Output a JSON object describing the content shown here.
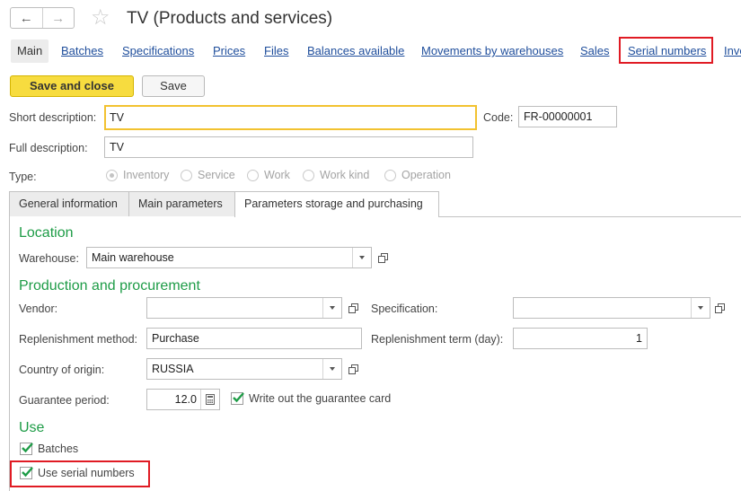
{
  "window": {
    "title": "TV (Products and services)",
    "favorite_icon": "star-outline-icon",
    "back_icon": "arrow-left-icon",
    "forward_icon": "arrow-right-icon"
  },
  "nav": {
    "links": [
      "Main",
      "Batches",
      "Specifications",
      "Prices",
      "Files",
      "Balances available",
      "Movements by warehouses",
      "Sales",
      "Serial numbers",
      "Inve"
    ],
    "active": "Main",
    "highlighted": "Serial numbers"
  },
  "toolbar": {
    "save_close_label": "Save and close",
    "save_label": "Save"
  },
  "form": {
    "short_description_label": "Short description:",
    "short_description_value": "TV",
    "code_label": "Code:",
    "code_value": "FR-00000001",
    "full_description_label": "Full description:",
    "full_description_value": "TV",
    "type_label": "Type:",
    "type_options": [
      "Inventory",
      "Service",
      "Work",
      "Work kind",
      "Operation"
    ],
    "type_selected": "Inventory"
  },
  "tabs": {
    "items": [
      "General information",
      "Main parameters",
      "Parameters storage and purchasing"
    ],
    "active": "Parameters storage and purchasing"
  },
  "location": {
    "heading": "Location",
    "warehouse_label": "Warehouse:",
    "warehouse_value": "Main warehouse"
  },
  "production": {
    "heading": "Production and procurement",
    "vendor_label": "Vendor:",
    "vendor_value": "",
    "specification_label": "Specification:",
    "specification_value": "",
    "replenishment_method_label": "Replenishment method:",
    "replenishment_method_value": "Purchase",
    "replenishment_term_label": "Replenishment term (day):",
    "replenishment_term_value": "1",
    "country_label": "Country of origin:",
    "country_value": "RUSSIA",
    "guarantee_label": "Guarantee period:",
    "guarantee_value": "12.0",
    "guarantee_card_label": "Write out the guarantee card",
    "guarantee_card_checked": true
  },
  "use": {
    "heading": "Use",
    "batches_label": "Batches",
    "batches_checked": true,
    "serial_label": "Use serial numbers",
    "serial_checked": true
  },
  "colors": {
    "accent_yellow": "#f7dc3f",
    "section_green": "#1e9c47",
    "link_blue": "#1f4e9c",
    "highlight_red": "#e01b24"
  }
}
